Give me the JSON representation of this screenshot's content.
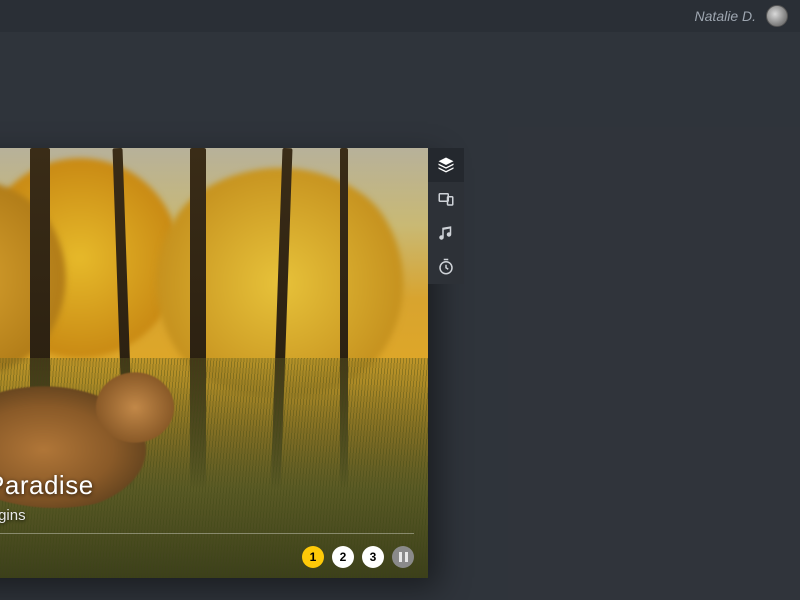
{
  "header": {
    "user_name": "Natalie D."
  },
  "slide": {
    "title": "Backyard Is Paradise",
    "subtitle": "Wildlife Photography Begins",
    "pages": [
      "1",
      "2",
      "3"
    ],
    "active_page_index": 0
  },
  "tools": [
    {
      "name": "layers-icon",
      "label": "Layers"
    },
    {
      "name": "devices-icon",
      "label": "Devices"
    },
    {
      "name": "music-icon",
      "label": "Music"
    },
    {
      "name": "timer-icon",
      "label": "Timer"
    }
  ]
}
